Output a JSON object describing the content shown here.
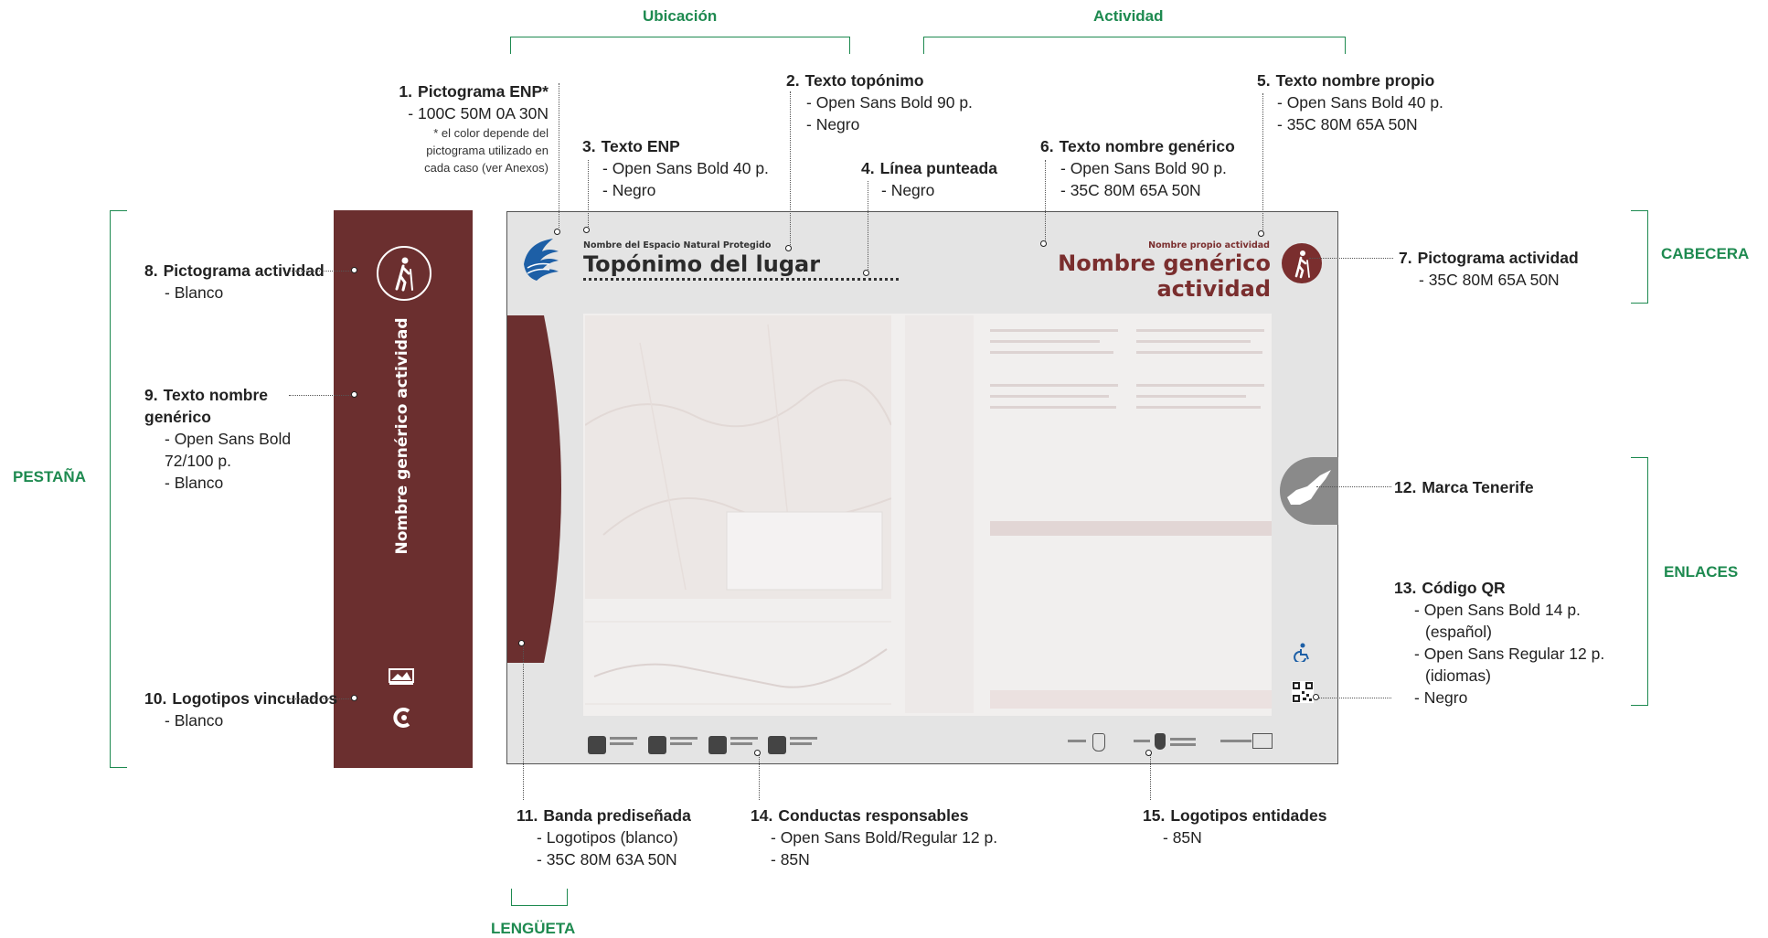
{
  "groups": {
    "ubicacion": "Ubicación",
    "actividad": "Actividad",
    "cabecera": "CABECERA",
    "enlaces": "ENLACES",
    "pestana": "PESTAÑA",
    "lengueta": "LENGÜETA"
  },
  "annotations": [
    {
      "num": "1.",
      "title": "Pictograma ENP*",
      "lines": [
        "- 100C 50M 0A 30N"
      ],
      "note": [
        "* el color depende del",
        "pictograma utilizado en",
        "cada caso (ver Anexos)"
      ]
    },
    {
      "num": "2.",
      "title": "Texto topónimo",
      "lines": [
        "- Open Sans Bold 90 p.",
        "- Negro"
      ]
    },
    {
      "num": "3.",
      "title": "Texto ENP",
      "lines": [
        "- Open Sans Bold 40 p.",
        "- Negro"
      ]
    },
    {
      "num": "4.",
      "title": "Línea punteada",
      "lines": [
        "- Negro"
      ]
    },
    {
      "num": "5.",
      "title": "Texto nombre propio",
      "lines": [
        "- Open Sans Bold 40 p.",
        "- 35C 80M 65A 50N"
      ]
    },
    {
      "num": "6.",
      "title": "Texto nombre genérico",
      "lines": [
        "- Open Sans Bold 90 p.",
        "- 35C 80M 65A 50N"
      ]
    },
    {
      "num": "7.",
      "title": "Pictograma actividad",
      "lines": [
        "- 35C 80M 65A 50N"
      ]
    },
    {
      "num": "8.",
      "title": "Pictograma actividad",
      "lines": [
        "- Blanco"
      ]
    },
    {
      "num": "9.",
      "title": "Texto nombre genérico",
      "lines": [
        "- Open Sans Bold",
        "72/100 p.",
        "- Blanco"
      ]
    },
    {
      "num": "10.",
      "title": "Logotipos vinculados",
      "lines": [
        "- Blanco"
      ]
    },
    {
      "num": "11.",
      "title": "Banda prediseñada",
      "lines": [
        "- Logotipos (blanco)",
        "- 35C 80M 63A 50N"
      ]
    },
    {
      "num": "12.",
      "title": "Marca Tenerife",
      "lines": []
    },
    {
      "num": "13.",
      "title": "Código QR",
      "lines": [
        "- Open Sans Bold 14 p.",
        "(español)",
        "- Open Sans Regular 12 p.",
        "(idiomas)",
        "- Negro"
      ]
    },
    {
      "num": "14.",
      "title": "Conductas responsables",
      "lines": [
        "- Open Sans Bold/Regular 12 p.",
        "- 85N"
      ]
    },
    {
      "num": "15.",
      "title": "Logotipos entidades",
      "lines": [
        "- 85N"
      ]
    }
  ],
  "panel": {
    "enp_text": "Nombre del Espacio Natural Protegido",
    "toponimo": "Topónimo del lugar",
    "nombre_propio": "Nombre propio actividad",
    "nombre_generico": "Nombre genérico actividad"
  },
  "tab": {
    "vertical_text": "Nombre genérico actividad"
  },
  "colors": {
    "accent_green": "#1e8a50",
    "burgundy": "#6b2f2f",
    "panel_bg": "#e4e4e4",
    "enp_blue": "#1d5fa6"
  },
  "icons": [
    "hiker-icon",
    "wave-enp-icon",
    "tenerife-island-icon",
    "accessibility-icon",
    "qr-code-icon"
  ]
}
